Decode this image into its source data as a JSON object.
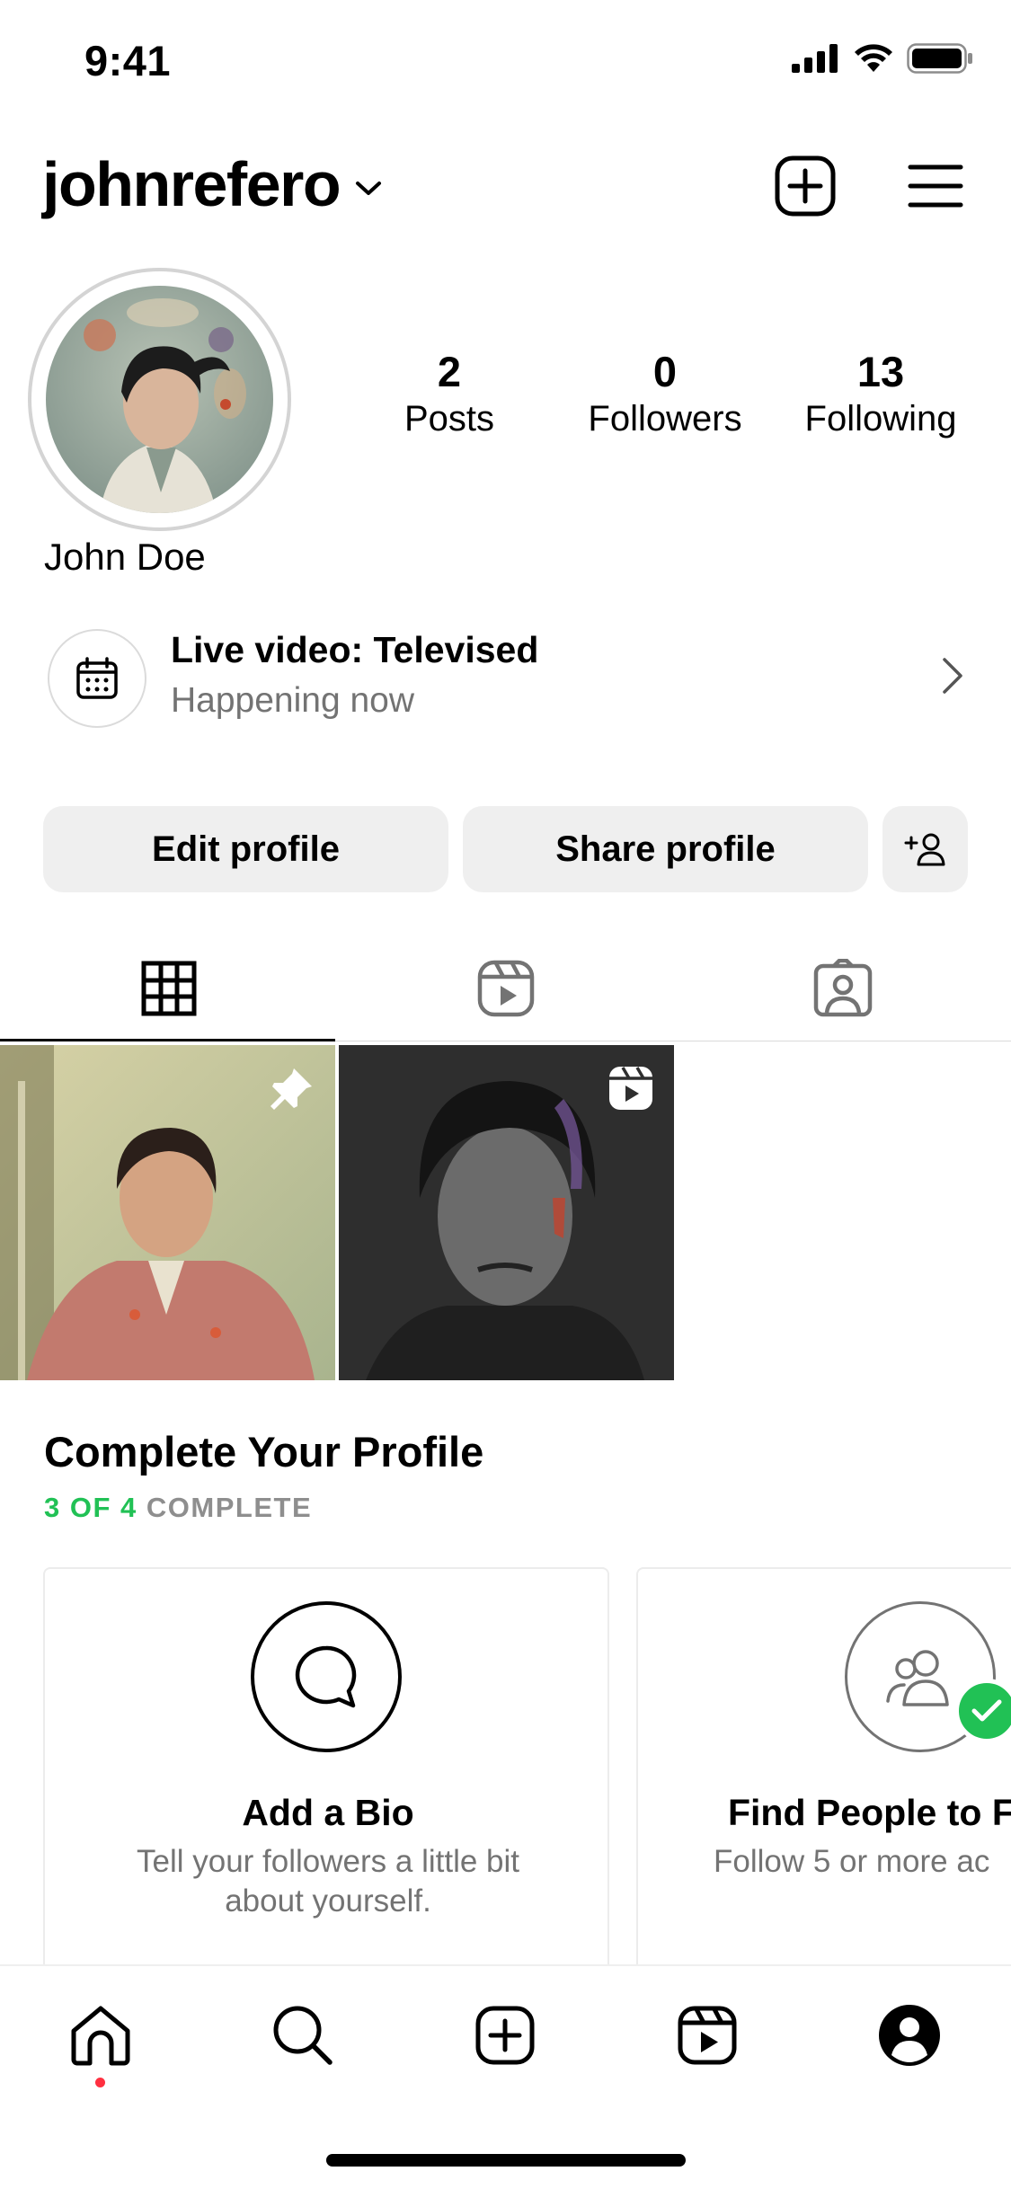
{
  "status_bar": {
    "time": "9:41"
  },
  "header": {
    "username": "johnrefero"
  },
  "profile": {
    "display_name": "John Doe",
    "stats": [
      {
        "value": "2",
        "label": "Posts"
      },
      {
        "value": "0",
        "label": "Followers"
      },
      {
        "value": "13",
        "label": "Following"
      }
    ]
  },
  "live": {
    "title": "Live video: Televised",
    "subtitle": "Happening now"
  },
  "actions": {
    "edit_label": "Edit profile",
    "share_label": "Share profile"
  },
  "tabs": [
    {
      "icon": "grid-icon",
      "active": true
    },
    {
      "icon": "reels-icon",
      "active": false
    },
    {
      "icon": "tagged-icon",
      "active": false
    }
  ],
  "posts": [
    {
      "badge_icon": "pin-icon"
    },
    {
      "badge_icon": "reels-icon"
    }
  ],
  "complete_profile": {
    "title": "Complete Your Profile",
    "progress_done": "3 OF 4",
    "progress_label": "COMPLETE",
    "progress_fraction": 0.75,
    "accent_color": "#21c155",
    "cards": [
      {
        "icon": "speech-bubble-icon",
        "title": "Add a Bio",
        "desc_line1": "Tell your followers a little bit",
        "desc_line2": "about yourself.",
        "completed": false
      },
      {
        "icon": "people-icon",
        "title": "Find People to F",
        "desc_line1": "Follow 5 or more ac",
        "desc_line2": "",
        "completed": true
      }
    ]
  },
  "bottom_nav": [
    "home-icon",
    "search-icon",
    "create-icon",
    "reels-icon",
    "profile-icon"
  ],
  "notification_color": "#ff3040"
}
